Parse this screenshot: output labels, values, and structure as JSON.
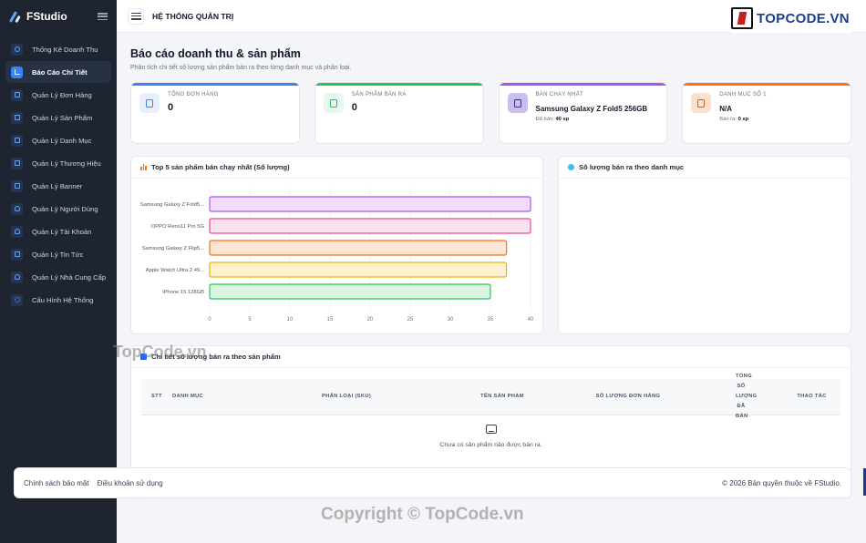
{
  "brand": {
    "name": "FStudio"
  },
  "sidebar": {
    "items": [
      {
        "label": "Thống Kê Doanh Thu",
        "icon": "cube-icon",
        "active": false
      },
      {
        "label": "Báo Cáo Chi Tiết",
        "icon": "bar-chart-icon",
        "active": true
      },
      {
        "label": "Quản Lý Đơn Hàng",
        "icon": "card-icon",
        "active": false
      },
      {
        "label": "Quản Lý Sản Phẩm",
        "icon": "cart-icon",
        "active": false
      },
      {
        "label": "Quản Lý Danh Mục",
        "icon": "copy-icon",
        "active": false
      },
      {
        "label": "Quản Lý Thương Hiệu",
        "icon": "copy-icon",
        "active": false
      },
      {
        "label": "Quản Lý Banner",
        "icon": "image-icon",
        "active": false
      },
      {
        "label": "Quản Lý Người Dùng",
        "icon": "user-icon",
        "active": false
      },
      {
        "label": "Quản Lý Tài Khoản",
        "icon": "users-icon",
        "active": false
      },
      {
        "label": "Quản Lý Tin Tức",
        "icon": "news-icon",
        "active": false
      },
      {
        "label": "Quản Lý Nhà Cung Cấp",
        "icon": "supplier-icon",
        "active": false
      },
      {
        "label": "Cấu Hình Hệ Thống",
        "icon": "gear-icon",
        "active": false
      }
    ]
  },
  "topbar": {
    "title": "HỆ THỐNG QUẢN TRỊ"
  },
  "topcode_logo": {
    "text_a": "TOPCODE",
    "text_b": ".VN"
  },
  "page": {
    "title": "Báo cáo doanh thu & sản phẩm",
    "subtitle": "Phân tích chi tiết số lượng sản phẩm bán ra theo từng danh mục và phân loại."
  },
  "stats": [
    {
      "label": "TỔNG ĐƠN HÀNG",
      "value": "0",
      "color": "#3b82f6",
      "bg": "#e8f0fe",
      "icon_color": "#3b82f6"
    },
    {
      "label": "SẢN PHẨM BÁN RA",
      "value": "0",
      "color": "#22c55e",
      "bg": "#e6f7ee",
      "icon_color": "#22c55e"
    },
    {
      "label": "BÁN CHẠY NHẤT",
      "value": "Samsung Galaxy Z Fold5 256GB",
      "note_prefix": "Đã bán:",
      "note_value": "40 sp",
      "color": "#a855f7",
      "bg": "#c9bff0",
      "icon_color": "#4c1d95"
    },
    {
      "label": "DANH MỤC SỐ 1",
      "value": "N/A",
      "note_prefix": "Bán ra:",
      "note_value": "0 sp",
      "color": "#f97316",
      "bg": "#fde1cf",
      "icon_color": "#ea580c"
    }
  ],
  "top_products": {
    "title": "Top 5 sản phẩm bán chạy nhất (Số lượng)"
  },
  "chart_data": {
    "type": "bar",
    "orientation": "horizontal",
    "categories": [
      "Samsung Galaxy Z Fold5...",
      "OPPO Reno11 Pro 5G",
      "Samsung Galaxy Z Flip5...",
      "Apple Watch Ultra 2 49...",
      "iPhone 15 128GB"
    ],
    "values": [
      40,
      40,
      37,
      37,
      35
    ],
    "colors": [
      "#a855f7",
      "#ec4899",
      "#f97316",
      "#eab308",
      "#22c55e"
    ],
    "fills": [
      "#f1ddfb",
      "#fbe0ee",
      "#fde3d2",
      "#fdf0cf",
      "#dcf5e3"
    ],
    "xlim": [
      0,
      40
    ],
    "xticks": [
      0,
      5,
      10,
      15,
      20,
      25,
      30,
      35,
      40
    ],
    "grid": true
  },
  "category_chart": {
    "title": "Số lượng bán ra theo danh mục"
  },
  "detail": {
    "title": "Chi tiết số lượng bán ra theo sản phẩm",
    "columns": [
      "STT",
      "DANH MỤC",
      "PHÂN LOẠI (SKU)",
      "TÊN SẢN PHẨM",
      "SỐ LƯỢNG ĐƠN HÀNG",
      "TỔNG SỐ LƯỢNG ĐÃ BÁN",
      "THAO TÁC"
    ],
    "empty_text": "Chưa có sản phẩm nào được bán ra."
  },
  "footer": {
    "link_privacy": "Chính sách bảo mật",
    "link_terms": "Điều khoản sử dụng",
    "copyright": "© 2026 Bản quyền thuộc về FStudio."
  },
  "watermark": {
    "text": "TopCode.vn",
    "text2": "Copyright © TopCode.vn"
  }
}
